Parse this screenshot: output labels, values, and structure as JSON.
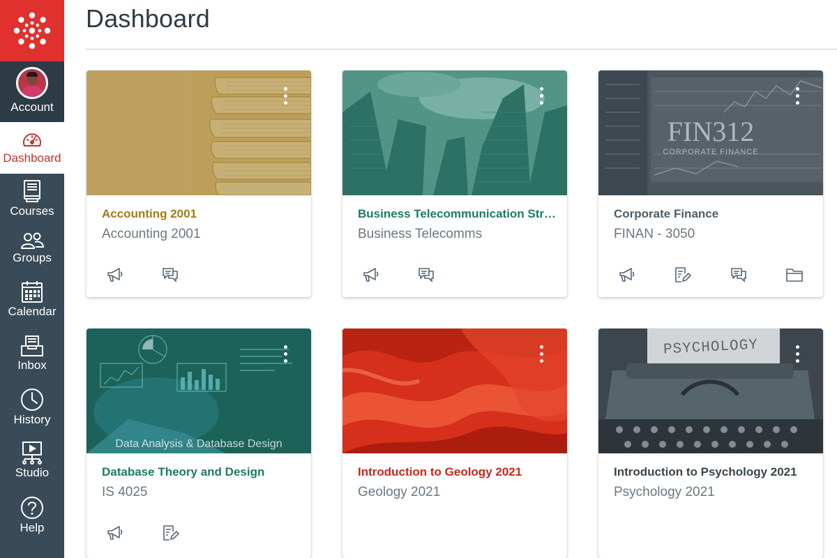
{
  "nav": {
    "logo": "canvas-logo-icon",
    "items": [
      {
        "label": "Account",
        "icon": "avatar"
      },
      {
        "label": "Dashboard",
        "icon": "dashboard-icon",
        "active": true
      },
      {
        "label": "Courses",
        "icon": "courses-icon"
      },
      {
        "label": "Groups",
        "icon": "groups-icon"
      },
      {
        "label": "Calendar",
        "icon": "calendar-icon"
      },
      {
        "label": "Inbox",
        "icon": "inbox-icon"
      },
      {
        "label": "History",
        "icon": "history-icon"
      },
      {
        "label": "Studio",
        "icon": "studio-icon"
      },
      {
        "label": "Help",
        "icon": "help-icon"
      }
    ],
    "colors": {
      "brand": "#e0312f",
      "nav_bg": "#394b58",
      "account_bg": "#2d3b45",
      "active_text": "#c7302c"
    }
  },
  "header": {
    "title": "Dashboard"
  },
  "cards": [
    {
      "title": "Accounting 2001",
      "subtitle": "Accounting 2001",
      "color": "#a07b18",
      "hero": "stacked-binders",
      "actions": [
        "announcements-icon",
        "discussions-icon"
      ]
    },
    {
      "title": "Business Telecommunication Strat...",
      "subtitle": "Business Telecomms",
      "color": "#1f7a62",
      "hero": "skyscrapers",
      "actions": [
        "announcements-icon",
        "discussions-icon"
      ]
    },
    {
      "title": "Corporate Finance",
      "subtitle": "FINAN - 3050",
      "color": "#4f5c66",
      "hero": "stock-screens",
      "hero_text": "FIN312",
      "hero_subtext": "CORPORATE FINANCE",
      "actions": [
        "announcements-icon",
        "assignments-icon",
        "discussions-icon",
        "files-icon"
      ]
    },
    {
      "title": "Database Theory and Design",
      "subtitle": "IS 4025",
      "color": "#1f7a62",
      "hero": "data-hologram",
      "hero_text": "Data Analysis & Database Design",
      "actions": [
        "announcements-icon",
        "assignments-icon"
      ]
    },
    {
      "title": "Introduction to Geology 2021",
      "subtitle": "Geology 2021",
      "color": "#c42a19",
      "hero": "canyon-rock",
      "actions": []
    },
    {
      "title": "Introduction to Psychology 2021",
      "subtitle": "Psychology 2021",
      "color": "#3b454d",
      "hero": "typewriter",
      "hero_text": "PSYCHOLOGY",
      "actions": []
    }
  ]
}
